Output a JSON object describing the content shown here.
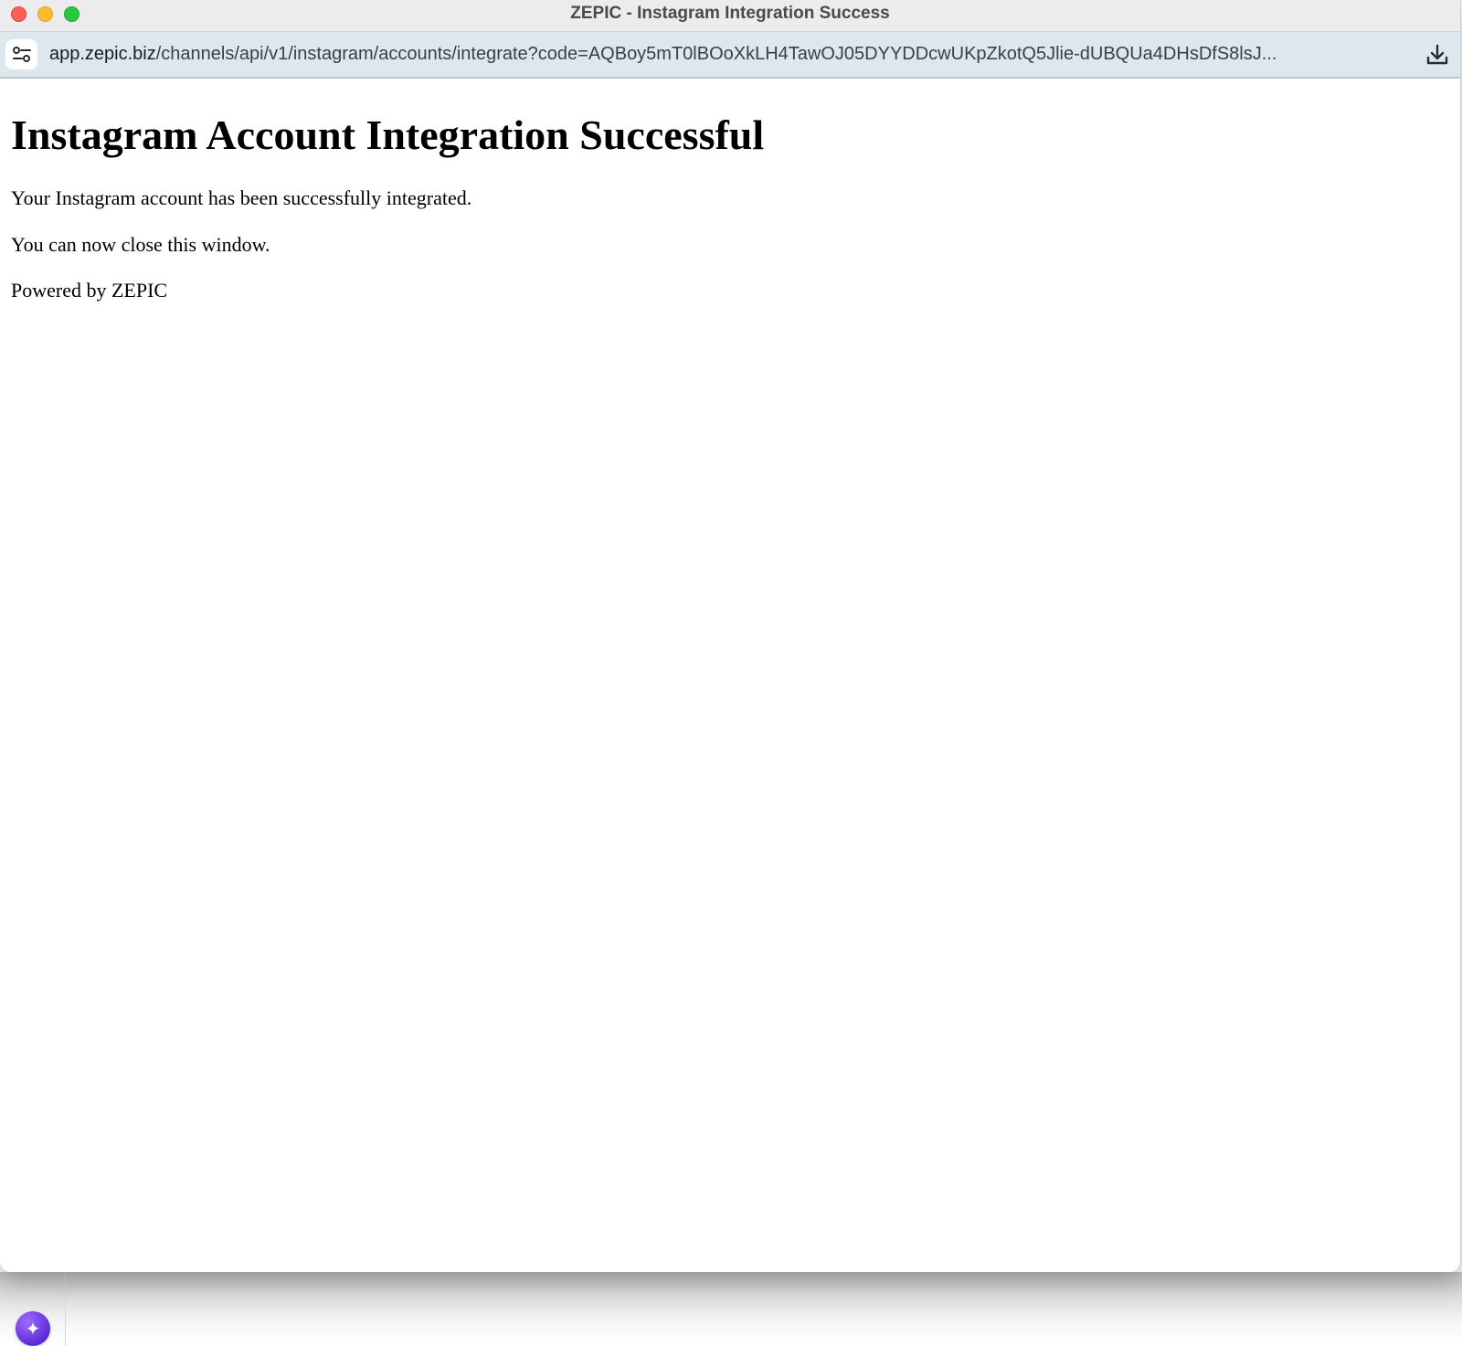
{
  "window": {
    "title": "ZEPIC - Instagram Integration Success"
  },
  "address_bar": {
    "url_host": "app.zepic.biz",
    "url_path": "/channels/api/v1/instagram/accounts/integrate?code=AQBoy5mT0lBOoXkLH4TawOJ05DYYDDcwUKpZkotQ5Jlie-dUBQUa4DHsDfS8lsJ..."
  },
  "page": {
    "heading": "Instagram Account Integration Successful",
    "message": "Your Instagram account has been successfully integrated.",
    "instruction": "You can now close this window.",
    "footer": "Powered by ZEPIC"
  },
  "icons": {
    "site_settings": "tune-icon",
    "download": "download-icon",
    "assistant": "sparkle-icon"
  },
  "colors": {
    "close": "#fe5f57",
    "minimize": "#febc2e",
    "zoom": "#28c840",
    "address_bar_bg": "#dce8ee",
    "assistant_accent": "#6a35e6"
  }
}
